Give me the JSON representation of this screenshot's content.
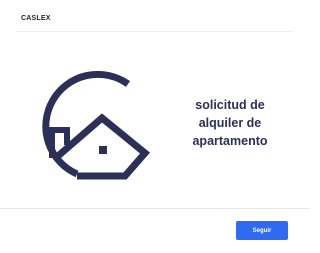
{
  "header": {
    "brand": "CASLEX"
  },
  "hero": {
    "logo_icon": "house-c-logo-icon",
    "logo_color": "#2c2f58",
    "title_lines": [
      "solicitud de",
      "alquiler de",
      "apartamento"
    ]
  },
  "footer": {
    "next_label": "Seguir",
    "button_color": "#2f6bf2"
  }
}
